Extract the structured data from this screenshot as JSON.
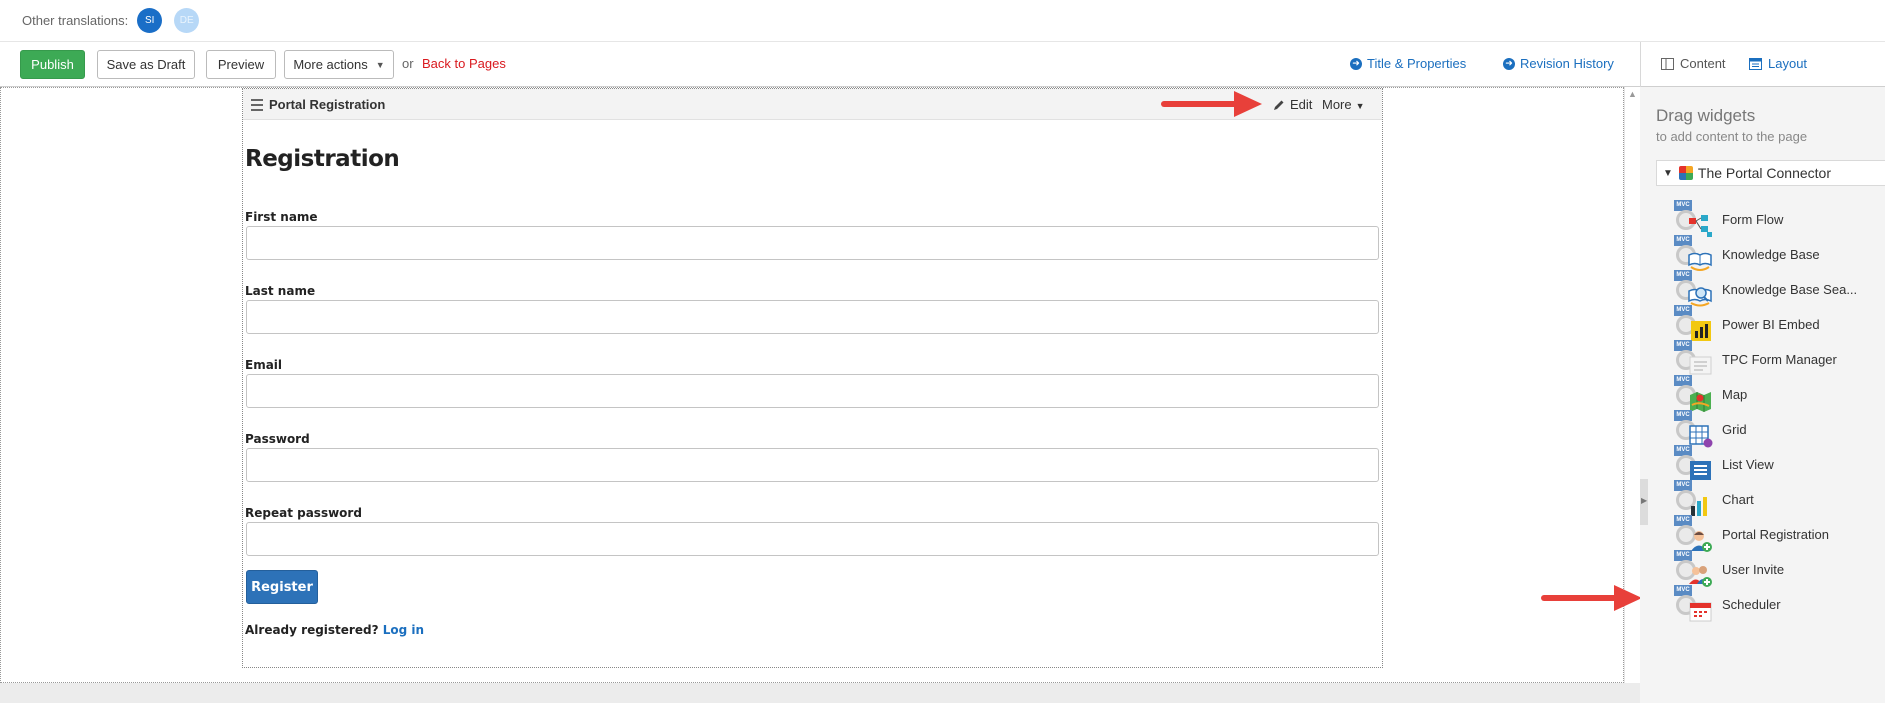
{
  "translations": {
    "label": "Other translations:",
    "languages": [
      {
        "code": "SI",
        "active": true
      },
      {
        "code": "DE",
        "active": false
      }
    ]
  },
  "toolbar": {
    "publish": "Publish",
    "save_draft": "Save as Draft",
    "preview": "Preview",
    "more_actions": "More actions",
    "or": "or",
    "back_to_pages": "Back to Pages",
    "title_properties": "Title & Properties",
    "revision_history": "Revision History",
    "view_content": "Content",
    "view_layout": "Layout"
  },
  "widget": {
    "title": "Portal Registration",
    "edit": "Edit",
    "more": "More"
  },
  "form": {
    "heading": "Registration",
    "fields": [
      {
        "label": "First name"
      },
      {
        "label": "Last name"
      },
      {
        "label": "Email"
      },
      {
        "label": "Password"
      },
      {
        "label": "Repeat password"
      }
    ],
    "submit": "Register",
    "already_text": "Already registered?",
    "login_link": "Log in"
  },
  "panel": {
    "heading": "Drag widgets",
    "subheading": "to add content to the page",
    "group": "The Portal Connector",
    "widgets": [
      {
        "label": "Form Flow",
        "icon": "form-flow-icon"
      },
      {
        "label": "Knowledge Base",
        "icon": "knowledge-base-icon"
      },
      {
        "label": "Knowledge Base Sea...",
        "icon": "knowledge-base-search-icon"
      },
      {
        "label": "Power BI Embed",
        "icon": "power-bi-icon"
      },
      {
        "label": "TPC Form Manager",
        "icon": "form-manager-icon"
      },
      {
        "label": "Map",
        "icon": "map-icon"
      },
      {
        "label": "Grid",
        "icon": "grid-icon"
      },
      {
        "label": "List View",
        "icon": "list-view-icon"
      },
      {
        "label": "Chart",
        "icon": "chart-icon"
      },
      {
        "label": "Portal Registration",
        "icon": "portal-registration-icon"
      },
      {
        "label": "User Invite",
        "icon": "user-invite-icon"
      },
      {
        "label": "Scheduler",
        "icon": "scheduler-icon"
      }
    ]
  },
  "colors": {
    "publish": "#3daa55",
    "link": "#1b6fbf",
    "back_link": "#d9191e",
    "register_button": "#2d72b8",
    "arrow": "#e8403a"
  }
}
